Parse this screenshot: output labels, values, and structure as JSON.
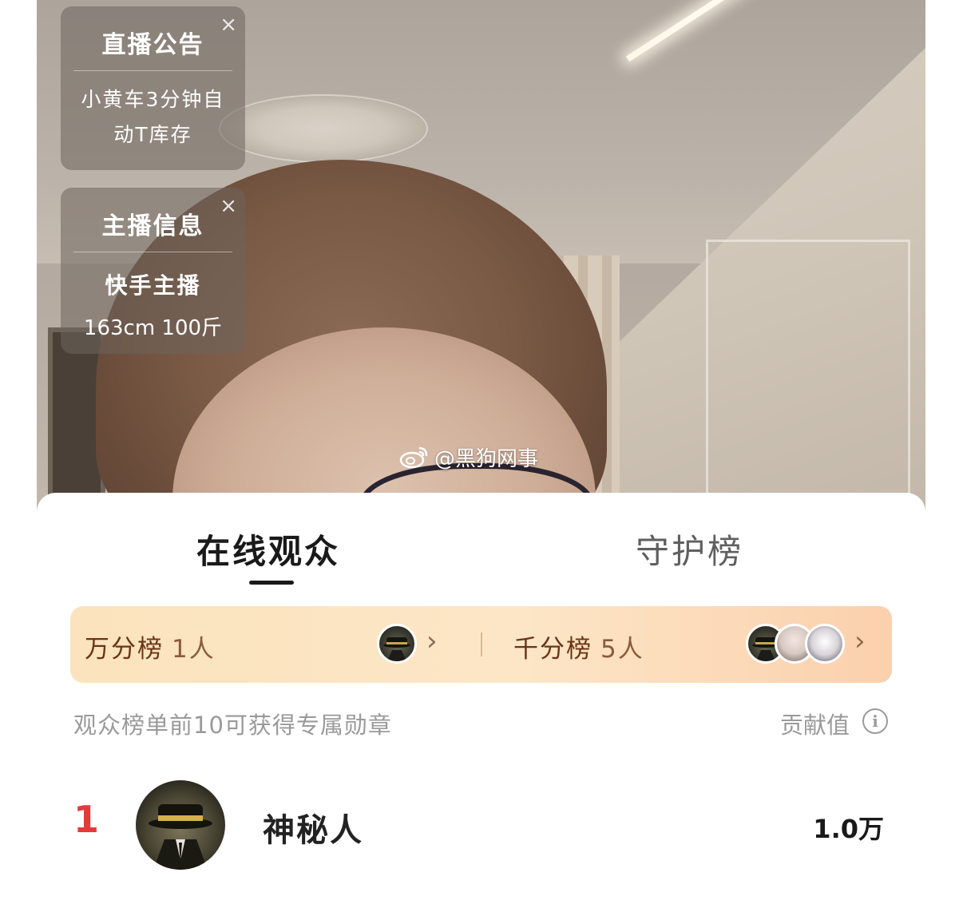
{
  "notice_card": {
    "title": "直播公告",
    "body_line1": "小黄车3分钟自",
    "body_line2": "动T库存",
    "close": "×"
  },
  "host_card": {
    "title": "主播信息",
    "name": "快手主播",
    "stats": "163cm 100斤",
    "close": "×"
  },
  "watermark": "@黑狗网事",
  "tabs": [
    {
      "label": "在线观众",
      "active": true
    },
    {
      "label": "守护榜",
      "active": false
    }
  ],
  "tiers": [
    {
      "label": "万分榜",
      "count": "1人",
      "arrow": "›"
    },
    {
      "label": "千分榜",
      "count": "5人",
      "arrow": "›"
    }
  ],
  "hint": "观众榜单前10可获得专属勋章",
  "contribution_label": "贡献值",
  "info_icon": "i",
  "leaderboard": [
    {
      "rank": "1",
      "name": "神秘人",
      "score": "1.0万"
    }
  ],
  "colors": {
    "rank_red": "#e23b3b",
    "tier_text": "#6a3418",
    "tier_bar_start": "#fbe3bd",
    "tier_bar_end": "#fbd0ad"
  }
}
